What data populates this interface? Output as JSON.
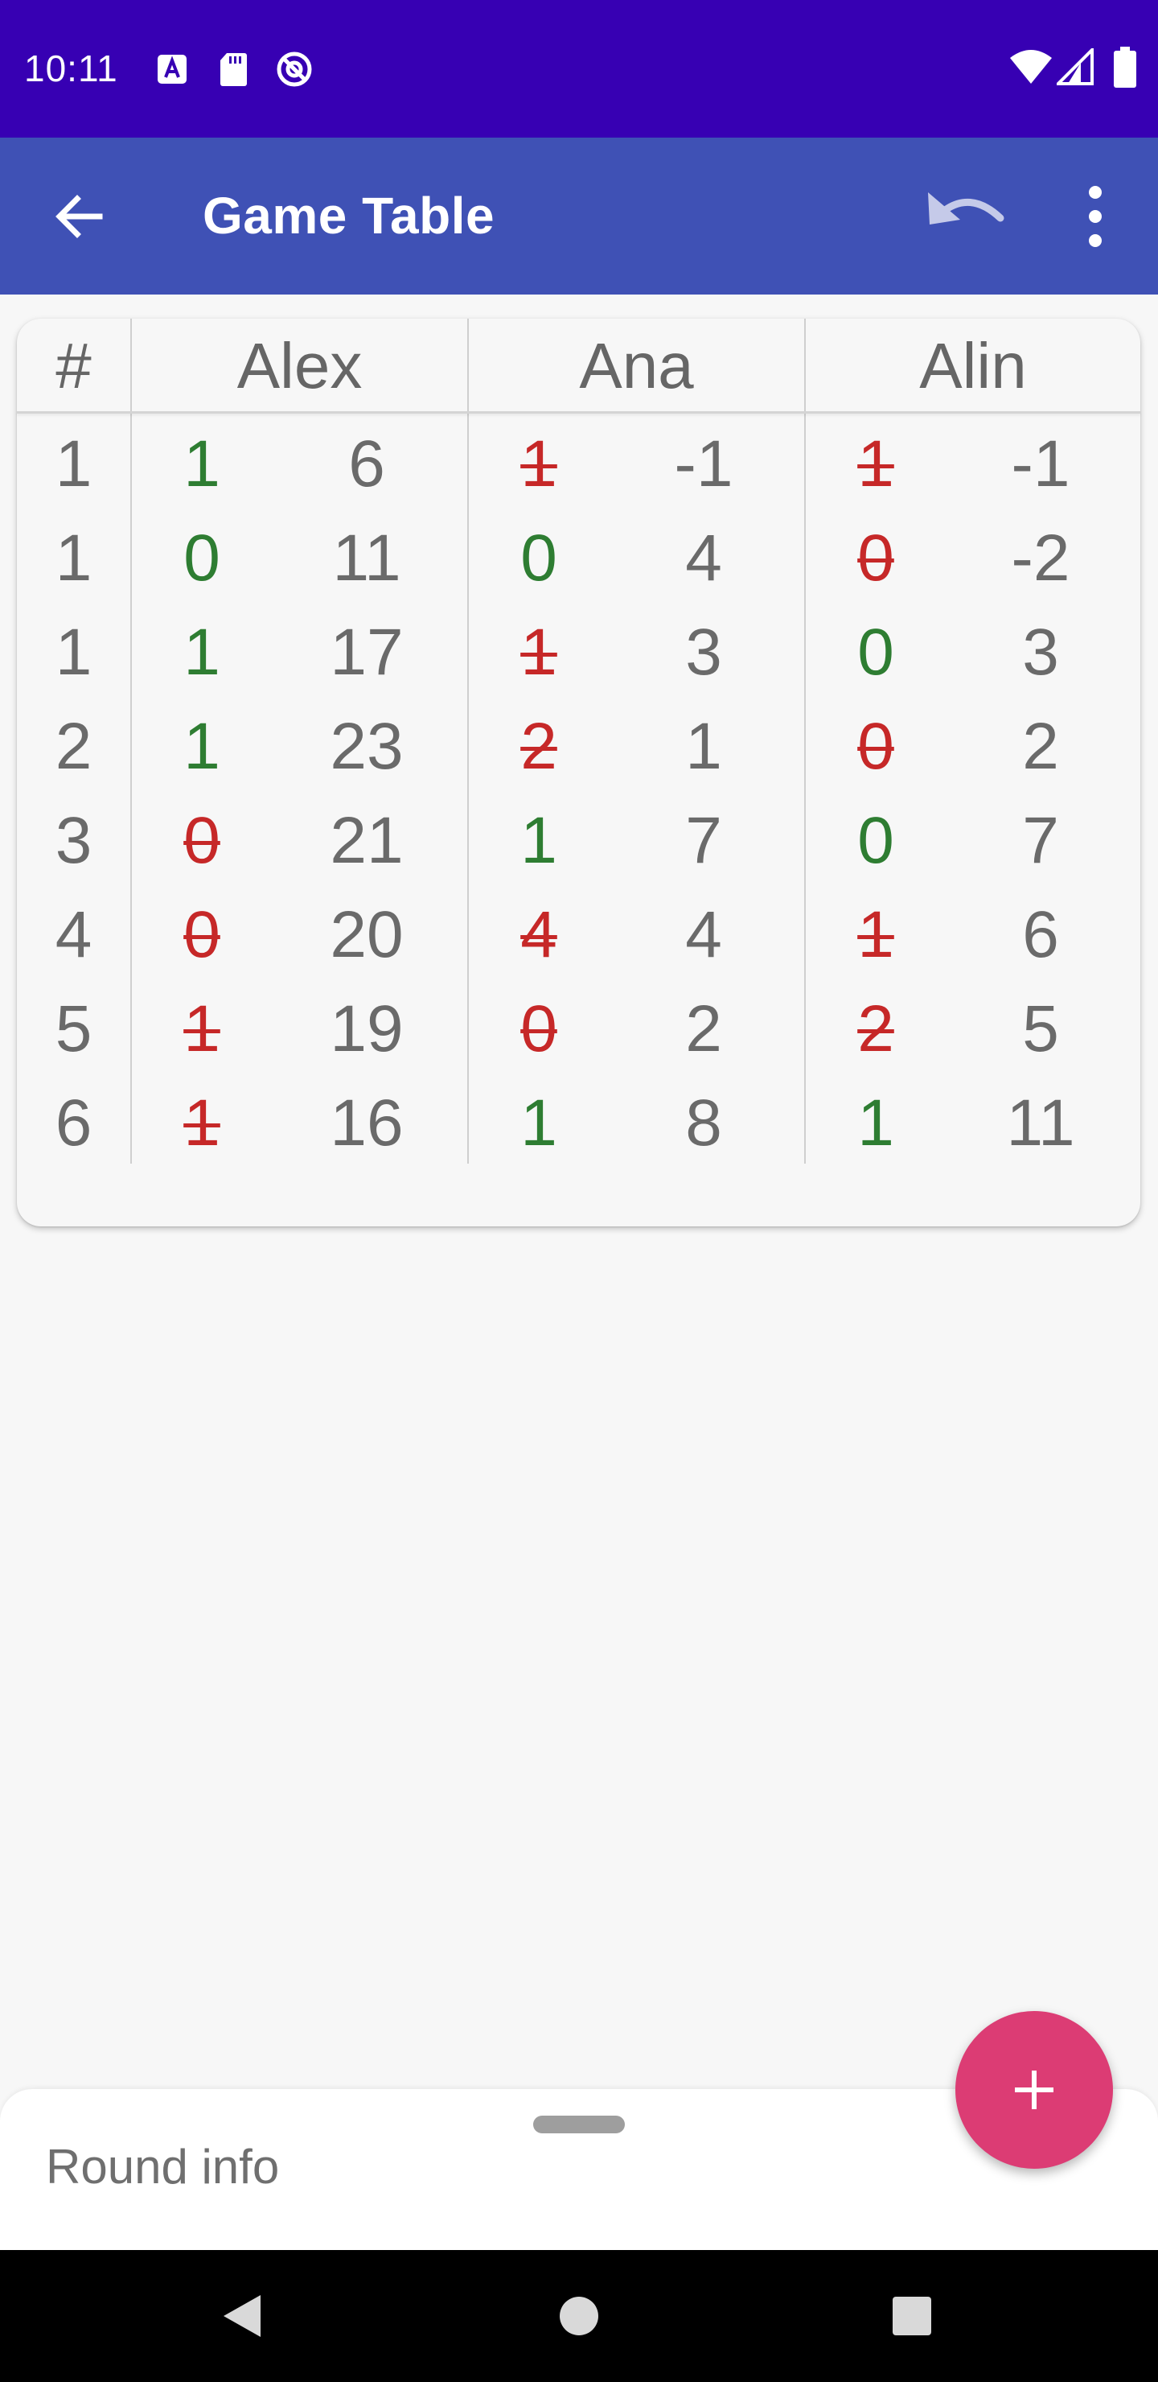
{
  "status": {
    "time": "10:11"
  },
  "appbar": {
    "title": "Game Table"
  },
  "table": {
    "index_header": "#",
    "players": [
      {
        "name": "Alex",
        "rounds": [
          {
            "bid": "1",
            "score": "6",
            "result": "made"
          },
          {
            "bid": "0",
            "score": "11",
            "result": "made"
          },
          {
            "bid": "1",
            "score": "17",
            "result": "made"
          },
          {
            "bid": "1",
            "score": "23",
            "result": "made"
          },
          {
            "bid": "0",
            "score": "21",
            "result": "missed"
          },
          {
            "bid": "0",
            "score": "20",
            "result": "missed"
          },
          {
            "bid": "1",
            "score": "19",
            "result": "missed"
          },
          {
            "bid": "1",
            "score": "16",
            "result": "missed"
          }
        ]
      },
      {
        "name": "Ana",
        "rounds": [
          {
            "bid": "1",
            "score": "-1",
            "result": "missed"
          },
          {
            "bid": "0",
            "score": "4",
            "result": "made"
          },
          {
            "bid": "1",
            "score": "3",
            "result": "missed"
          },
          {
            "bid": "2",
            "score": "1",
            "result": "missed"
          },
          {
            "bid": "1",
            "score": "7",
            "result": "made"
          },
          {
            "bid": "4",
            "score": "4",
            "result": "missed"
          },
          {
            "bid": "0",
            "score": "2",
            "result": "missed"
          },
          {
            "bid": "1",
            "score": "8",
            "result": "made"
          }
        ]
      },
      {
        "name": "Alin",
        "rounds": [
          {
            "bid": "1",
            "score": "-1",
            "result": "missed"
          },
          {
            "bid": "0",
            "score": "-2",
            "result": "missed"
          },
          {
            "bid": "0",
            "score": "3",
            "result": "made"
          },
          {
            "bid": "0",
            "score": "2",
            "result": "missed"
          },
          {
            "bid": "0",
            "score": "7",
            "result": "made"
          },
          {
            "bid": "1",
            "score": "6",
            "result": "missed"
          },
          {
            "bid": "2",
            "score": "5",
            "result": "missed"
          },
          {
            "bid": "1",
            "score": "11",
            "result": "made"
          }
        ]
      }
    ],
    "round_numbers": [
      "1",
      "1",
      "1",
      "2",
      "3",
      "4",
      "5",
      "6"
    ]
  },
  "sheet": {
    "label": "Round info"
  },
  "colors": {
    "statusbar": "#3700b3",
    "appbar": "#3f51b5",
    "made": "#2e7d32",
    "missed": "#c62828",
    "fab": "#dc3c74"
  },
  "icons": [
    "back-arrow-icon",
    "undo-icon",
    "more-vert-icon",
    "add-icon",
    "nav-back-icon",
    "nav-home-icon",
    "nav-recents-icon"
  ]
}
